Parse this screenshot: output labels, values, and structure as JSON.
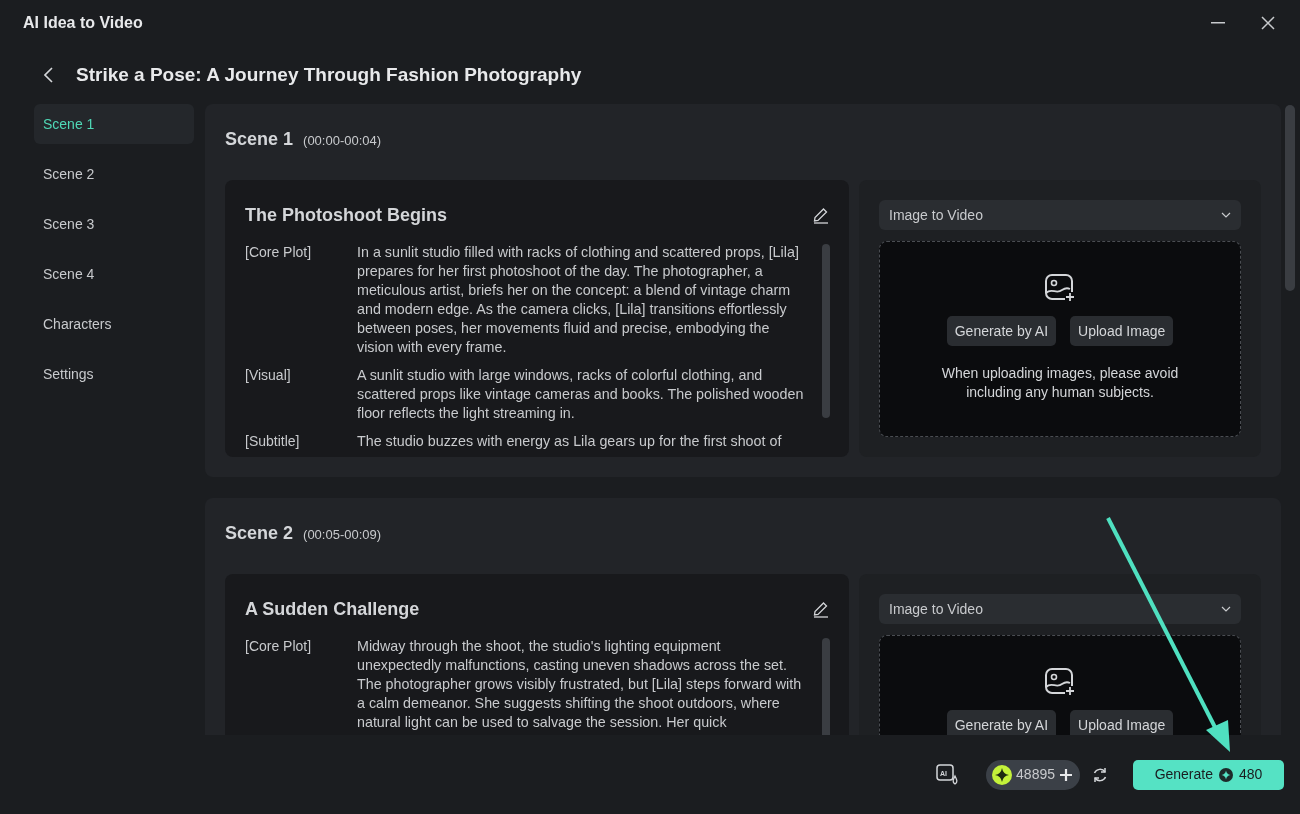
{
  "window": {
    "title": "AI Idea to Video"
  },
  "header": {
    "title": "Strike a Pose: A Journey Through Fashion Photography"
  },
  "sidebar": {
    "items": [
      {
        "label": "Scene 1",
        "selected": true
      },
      {
        "label": "Scene 2",
        "selected": false
      },
      {
        "label": "Scene 3",
        "selected": false
      },
      {
        "label": "Scene 4",
        "selected": false
      },
      {
        "label": "Characters",
        "selected": false
      },
      {
        "label": "Settings",
        "selected": false
      }
    ]
  },
  "scenes": [
    {
      "name": "Scene 1",
      "time": "(00:00-00:04)",
      "title": "The Photoshoot Begins",
      "sections": [
        {
          "label": "[Core Plot]",
          "text": "In a sunlit studio filled with racks of clothing and scattered props, [Lila] prepares for her first photoshoot of the day. The photographer, a meticulous artist, briefs her on the concept: a blend of vintage charm and modern edge. As the camera clicks, [Lila] transitions effortlessly between poses, her movements fluid and precise, embodying the vision with every frame."
        },
        {
          "label": "[Visual]",
          "text": "A sunlit studio with large windows, racks of colorful clothing, and scattered props like vintage cameras and books. The polished wooden floor reflects the light streaming in."
        },
        {
          "label": "[Subtitle]",
          "text": "The studio buzzes with energy as Lila gears up for the first shoot of"
        }
      ],
      "mode": "Image to Video",
      "buttons": [
        "Generate by AI",
        "Upload Image"
      ],
      "note": "When uploading images, please avoid including any human subjects."
    },
    {
      "name": "Scene 2",
      "time": "(00:05-00:09)",
      "title": "A Sudden Challenge",
      "sections": [
        {
          "label": "[Core Plot]",
          "text": "Midway through the shoot, the studio's lighting equipment unexpectedly malfunctions, casting uneven shadows across the set. The photographer grows visibly frustrated, but [Lila] steps forward with a calm demeanor. She suggests shifting the shoot outdoors, where natural light can be used to salvage the session. Her quick"
        }
      ],
      "mode": "Image to Video",
      "buttons": [
        "Generate by AI",
        "Upload Image"
      ]
    }
  ],
  "footer": {
    "icon_text": "AI",
    "credits": "48895",
    "generate": "Generate",
    "cost": "480"
  }
}
